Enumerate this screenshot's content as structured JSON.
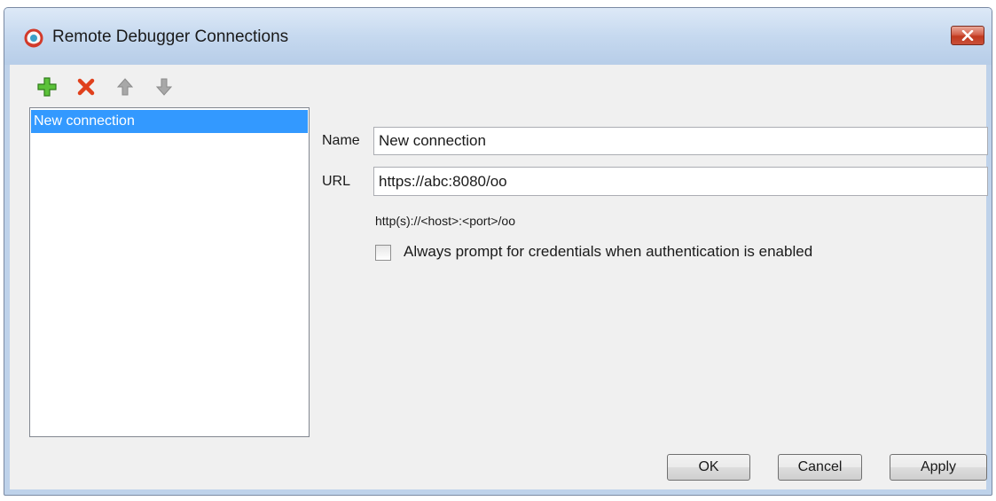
{
  "window": {
    "title": "Remote Debugger Connections"
  },
  "toolbar": {
    "add_icon": "plus-icon",
    "remove_icon": "x-icon",
    "move_up_icon": "arrow-up-icon",
    "move_down_icon": "arrow-down-icon"
  },
  "connections": {
    "items": [
      {
        "label": "New connection",
        "selected": true
      }
    ]
  },
  "form": {
    "name_label": "Name",
    "name_value": "New connection",
    "url_label": "URL",
    "url_value": "https://abc:8080/oo",
    "url_hint": "http(s)://<host>:<port>/oo",
    "prompt_credentials_label": "Always prompt for credentials when authentication is enabled",
    "prompt_credentials_checked": false
  },
  "buttons": {
    "ok": "OK",
    "cancel": "Cancel",
    "apply": "Apply"
  },
  "colors": {
    "selection": "#3399ff",
    "add_icon": "#4caf2a",
    "remove_icon": "#e0401c",
    "arrow_icon": "#9a9a9a",
    "close_button": "#c0391f"
  }
}
